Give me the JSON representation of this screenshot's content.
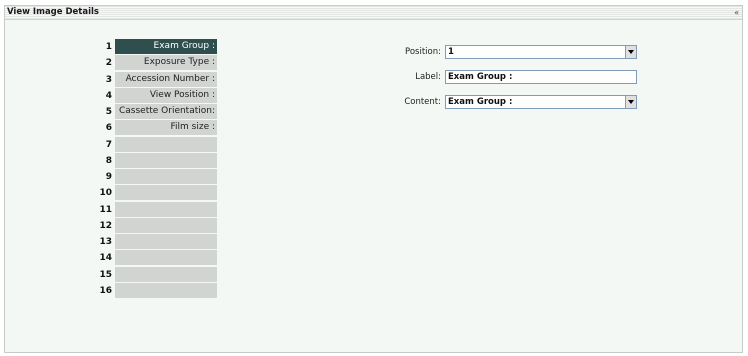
{
  "window": {
    "title": "View Image Details",
    "collapse_glyph": "«"
  },
  "selected_index": 0,
  "rows": [
    {
      "num": "1",
      "label": "Exam Group :"
    },
    {
      "num": "2",
      "label": "Exposure Type :"
    },
    {
      "num": "3",
      "label": "Accession Number :"
    },
    {
      "num": "4",
      "label": "View Position :"
    },
    {
      "num": "5",
      "label": "Cassette Orientation:"
    },
    {
      "num": "6",
      "label": "Film size :"
    },
    {
      "num": "7",
      "label": ""
    },
    {
      "num": "8",
      "label": ""
    },
    {
      "num": "9",
      "label": ""
    },
    {
      "num": "10",
      "label": ""
    },
    {
      "num": "11",
      "label": ""
    },
    {
      "num": "12",
      "label": ""
    },
    {
      "num": "13",
      "label": ""
    },
    {
      "num": "14",
      "label": ""
    },
    {
      "num": "15",
      "label": ""
    },
    {
      "num": "16",
      "label": ""
    }
  ],
  "form": {
    "position_label": "Position:",
    "position_value": "1",
    "label_label": "Label:",
    "label_value": "Exam Group :",
    "content_label": "Content:",
    "content_value": "Exam Group :"
  }
}
